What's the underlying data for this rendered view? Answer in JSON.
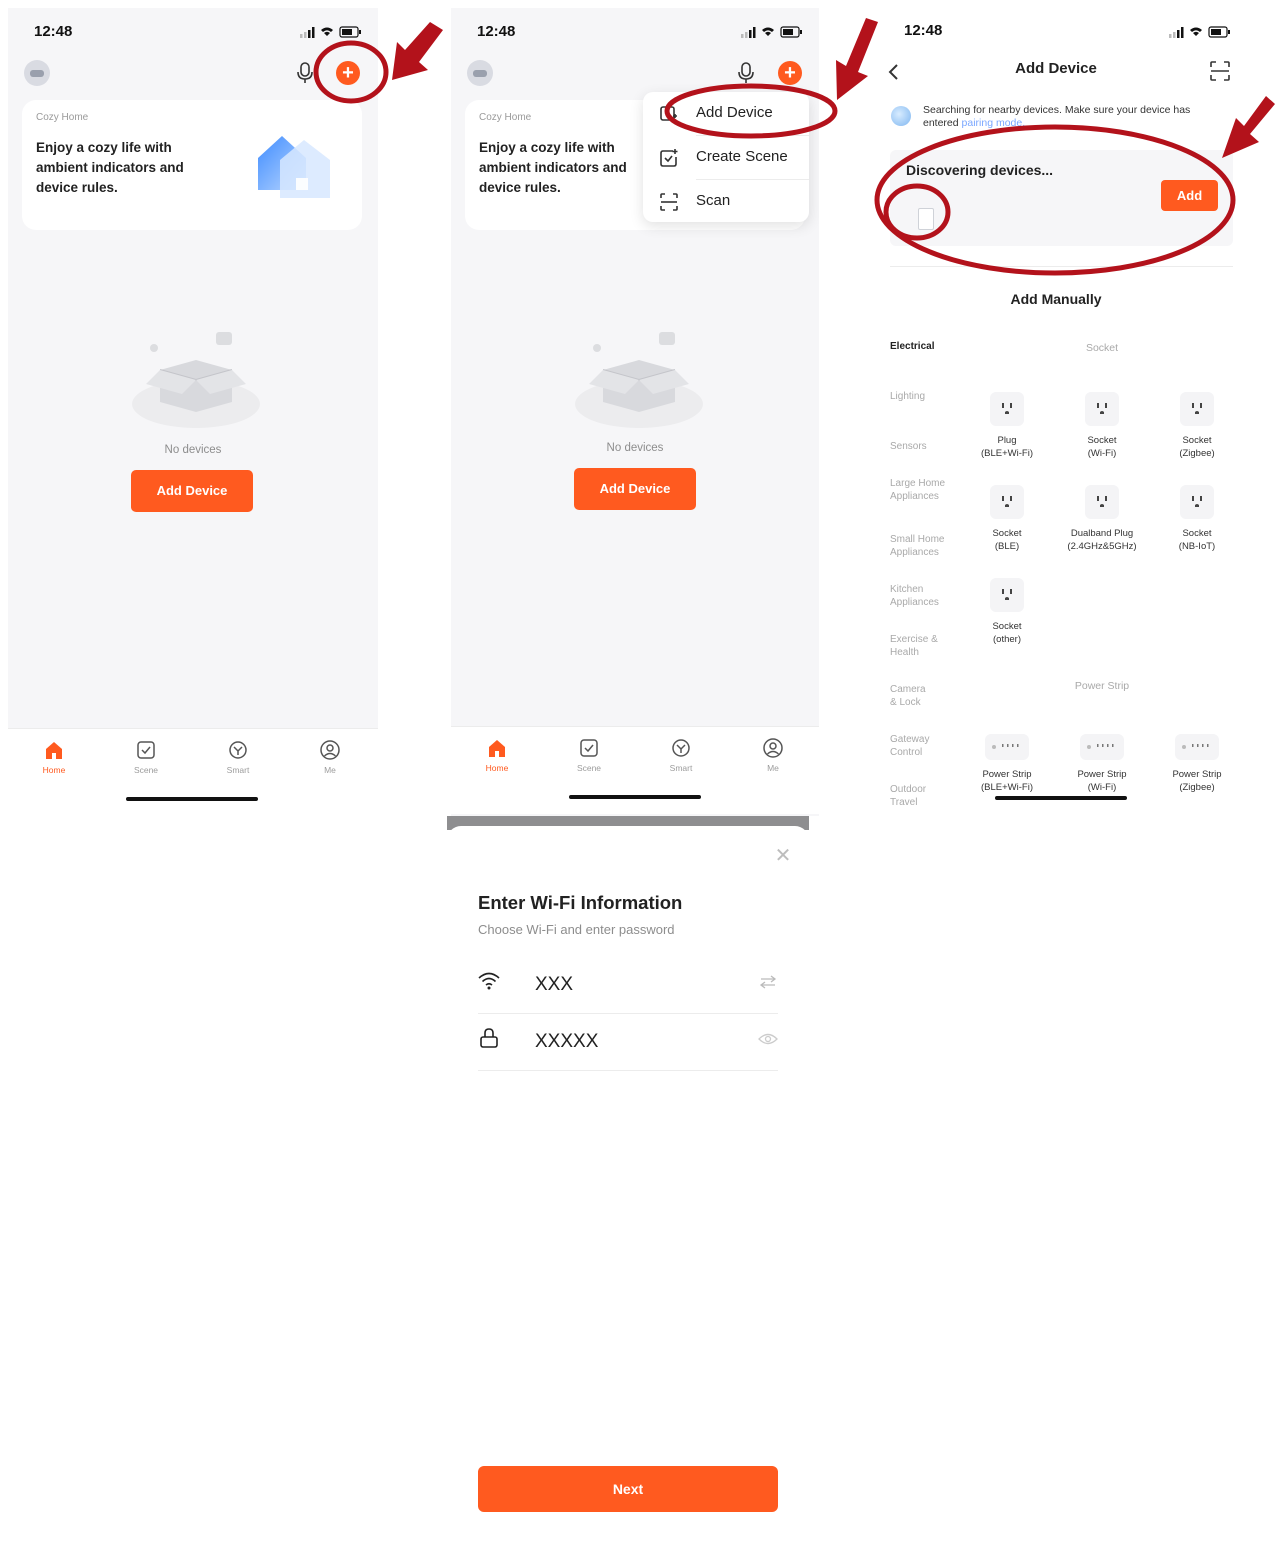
{
  "theme": {
    "accent": "#ff5a1f",
    "annotation": "#b3121b"
  },
  "status": {
    "time": "12:48"
  },
  "home": {
    "card_label": "Cozy Home",
    "card_text": "Enjoy a cozy life with ambient indicators and device rules.",
    "empty_text": "No devices",
    "add_button": "Add Device"
  },
  "tabs": [
    "Home",
    "Scene",
    "Smart",
    "Me"
  ],
  "menu": {
    "items": [
      "Add Device",
      "Create Scene",
      "Scan"
    ]
  },
  "add_device": {
    "title": "Add Device",
    "search_text": "Searching for nearby devices. Make sure your device has entered ",
    "search_link": "pairing mode.",
    "discovering": "Discovering devices...",
    "add_button": "Add",
    "manual_title": "Add Manually",
    "categories": [
      "Electrical",
      "Lighting",
      "Sensors",
      "Large Home Appliances",
      "Small Home Appliances",
      "Kitchen Appliances",
      "Exercise & Health",
      "Camera & Lock",
      "Gateway Control",
      "Outdoor Travel"
    ],
    "section_socket": "Socket",
    "section_strip": "Power Strip",
    "sockets": [
      {
        "name": "Plug",
        "sub": "(BLE+Wi-Fi)"
      },
      {
        "name": "Socket",
        "sub": "(Wi-Fi)"
      },
      {
        "name": "Socket",
        "sub": "(Zigbee)"
      },
      {
        "name": "Socket",
        "sub": "(BLE)"
      },
      {
        "name": "Dualband Plug",
        "sub": "(2.4GHz&5GHz)"
      },
      {
        "name": "Socket",
        "sub": "(NB-IoT)"
      },
      {
        "name": "Socket",
        "sub": "(other)"
      }
    ],
    "strips": [
      {
        "name": "Power Strip",
        "sub": "(BLE+Wi-Fi)"
      },
      {
        "name": "Power Strip",
        "sub": "(Wi-Fi)"
      },
      {
        "name": "Power Strip",
        "sub": "(Zigbee)"
      }
    ]
  },
  "wifi": {
    "title": "Enter Wi-Fi Information",
    "subtitle": "Choose Wi-Fi and enter password",
    "ssid": "XXX",
    "password": "XXXXX",
    "next": "Next"
  }
}
